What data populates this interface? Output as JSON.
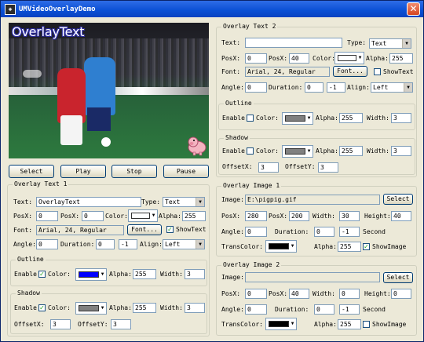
{
  "window": {
    "title": "UMVideoOverlayDemo",
    "app_icon": "app-icon",
    "close_icon": "close-icon"
  },
  "video": {
    "overlay_text": "OverlayText",
    "overlay_image": "pig-image"
  },
  "buttons": {
    "select_media": "Select Media",
    "play": "Play",
    "stop": "Stop",
    "pause": "Pause"
  },
  "labels": {
    "text": "Text:",
    "type": "Type:",
    "posx": "PosX:",
    "posy": "PosX:",
    "color": "Color:",
    "alpha": "Alpha:",
    "font": "Font:",
    "font_btn": "Font...",
    "show_text": "ShowText",
    "angle": "Angle:",
    "duration": "Duration:",
    "align": "Align:",
    "enable": "Enable",
    "width": "Width:",
    "offsetx": "OffsetX:",
    "offsety": "OffsetY:",
    "image": "Image:",
    "height": "Height:",
    "second": "Second",
    "trans_color": "TransColor:",
    "show_image": "ShowImage",
    "select": "Select"
  },
  "colors": {
    "black": "#000000",
    "white": "#ffffff",
    "gray": "#808080",
    "blue": "#0000ff"
  },
  "overlay_text_1": {
    "title": "Overlay Text 1",
    "text": "OverlayText",
    "type": "Text",
    "posx": "0",
    "posy": "0",
    "color": "#ffffff",
    "alpha": "255",
    "font": "Arial, 24, Regular",
    "show_text": true,
    "angle": "0",
    "duration_a": "0",
    "duration_b": "-1",
    "align": "Left",
    "outline": {
      "title": "Outline",
      "enable": true,
      "color": "#0000ff",
      "alpha": "255",
      "width": "3"
    },
    "shadow": {
      "title": "Shadow",
      "enable": true,
      "color": "#808080",
      "alpha": "255",
      "width": "3",
      "offsetx": "3",
      "offsety": "3"
    }
  },
  "overlay_text_2": {
    "title": "Overlay Text 2",
    "text": "",
    "type": "Text",
    "posx": "0",
    "posy": "40",
    "color": "#ffffff",
    "alpha": "255",
    "font": "Arial, 24, Regular",
    "show_text": false,
    "angle": "0",
    "duration_a": "0",
    "duration_b": "-1",
    "align": "Left",
    "outline": {
      "title": "Outline",
      "enable": false,
      "color": "#808080",
      "alpha": "255",
      "width": "3"
    },
    "shadow": {
      "title": "Shadow",
      "enable": false,
      "color": "#808080",
      "alpha": "255",
      "width": "3",
      "offsetx": "3",
      "offsety": "3"
    }
  },
  "overlay_image_1": {
    "title": "Overlay Image 1",
    "image": "E:\\pigpig.gif",
    "posx": "280",
    "posy": "200",
    "width": "30",
    "height": "40",
    "angle": "0",
    "duration_a": "0",
    "duration_b": "-1",
    "trans_color": "#000000",
    "alpha": "255",
    "show_image": true
  },
  "overlay_image_2": {
    "title": "Overlay Image 2",
    "image": "",
    "posx": "0",
    "posy": "40",
    "width": "0",
    "height": "0",
    "angle": "0",
    "duration_a": "0",
    "duration_b": "-1",
    "trans_color": "#000000",
    "alpha": "255",
    "show_image": false
  }
}
